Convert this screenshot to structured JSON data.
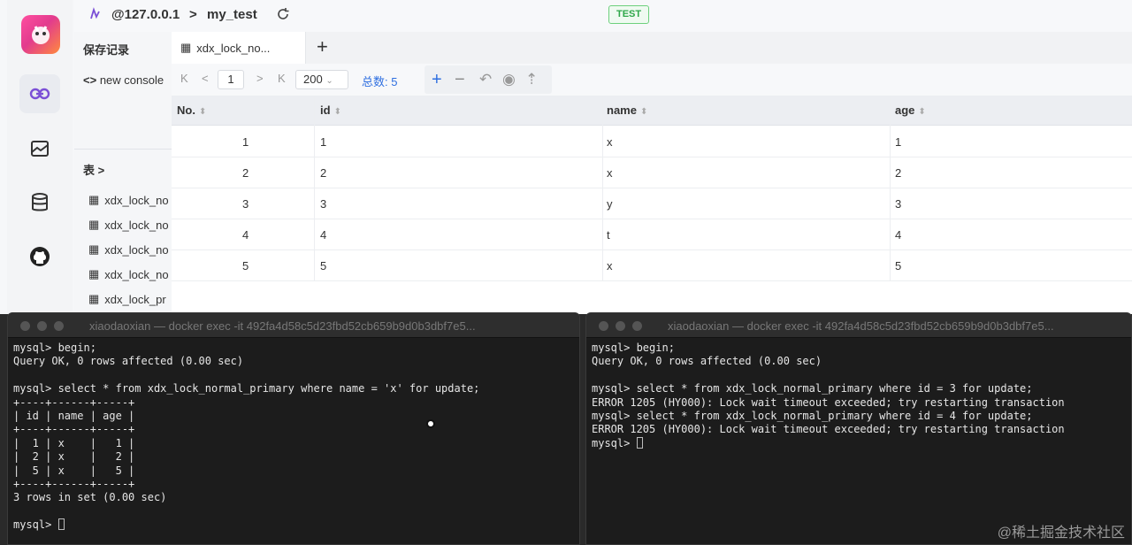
{
  "topbar": {
    "host": "@127.0.0.1",
    "separator": ">",
    "database": "my_test",
    "env_badge": "TEST"
  },
  "side_panel": {
    "save_records": "保存记录",
    "console": "new console",
    "tables_label": "表 >",
    "tables": [
      "xdx_lock_no",
      "xdx_lock_no",
      "xdx_lock_no",
      "xdx_lock_no",
      "xdx_lock_pr"
    ]
  },
  "tabs": {
    "active_tab": "xdx_lock_no..."
  },
  "toolbar": {
    "first": "K",
    "prev": "<",
    "page": "1",
    "next": ">",
    "last": "K",
    "page_size": "200",
    "total_label": "总数:",
    "total_value": "5"
  },
  "grid": {
    "columns": [
      "No.",
      "id",
      "name",
      "age"
    ],
    "rows": [
      {
        "no": "1",
        "id": "1",
        "name": "x",
        "age": "1"
      },
      {
        "no": "2",
        "id": "2",
        "name": "x",
        "age": "2"
      },
      {
        "no": "3",
        "id": "3",
        "name": "y",
        "age": "3"
      },
      {
        "no": "4",
        "id": "4",
        "name": "t",
        "age": "4"
      },
      {
        "no": "5",
        "id": "5",
        "name": "x",
        "age": "5"
      }
    ]
  },
  "terminal_left": {
    "title": "xiaodaoxian — docker exec -it 492fa4d58c5d23fbd52cb659b9d0b3dbf7e5...",
    "lines": [
      "mysql> begin;",
      "Query OK, 0 rows affected (0.00 sec)",
      "",
      "mysql> select * from xdx_lock_normal_primary where name = 'x' for update;",
      "+----+------+-----+",
      "| id | name | age |",
      "+----+------+-----+",
      "|  1 | x    |   1 |",
      "|  2 | x    |   2 |",
      "|  5 | x    |   5 |",
      "+----+------+-----+",
      "3 rows in set (0.00 sec)",
      "",
      "mysql> "
    ]
  },
  "terminal_right": {
    "title": "xiaodaoxian — docker exec -it 492fa4d58c5d23fbd52cb659b9d0b3dbf7e5...",
    "lines": [
      "mysql> begin;",
      "Query OK, 0 rows affected (0.00 sec)",
      "",
      "mysql> select * from xdx_lock_normal_primary where id = 3 for update;",
      "ERROR 1205 (HY000): Lock wait timeout exceeded; try restarting transaction",
      "mysql> select * from xdx_lock_normal_primary where id = 4 for update;",
      "ERROR 1205 (HY000): Lock wait timeout exceeded; try restarting transaction",
      "mysql> "
    ]
  },
  "watermark": "@稀土掘金技术社区",
  "colors": {
    "accent": "#7b4fd6",
    "total": "#2f6fe0",
    "badge_green": "#2fa84a",
    "terminal_bg": "#1c1c1c"
  },
  "icons": [
    "logo-icon",
    "connection-icon",
    "dashboard-icon",
    "database-icon",
    "github-icon",
    "table-icon",
    "refresh-icon",
    "add-row-icon",
    "delete-row-icon",
    "undo-icon",
    "preview-icon",
    "commit-icon"
  ]
}
